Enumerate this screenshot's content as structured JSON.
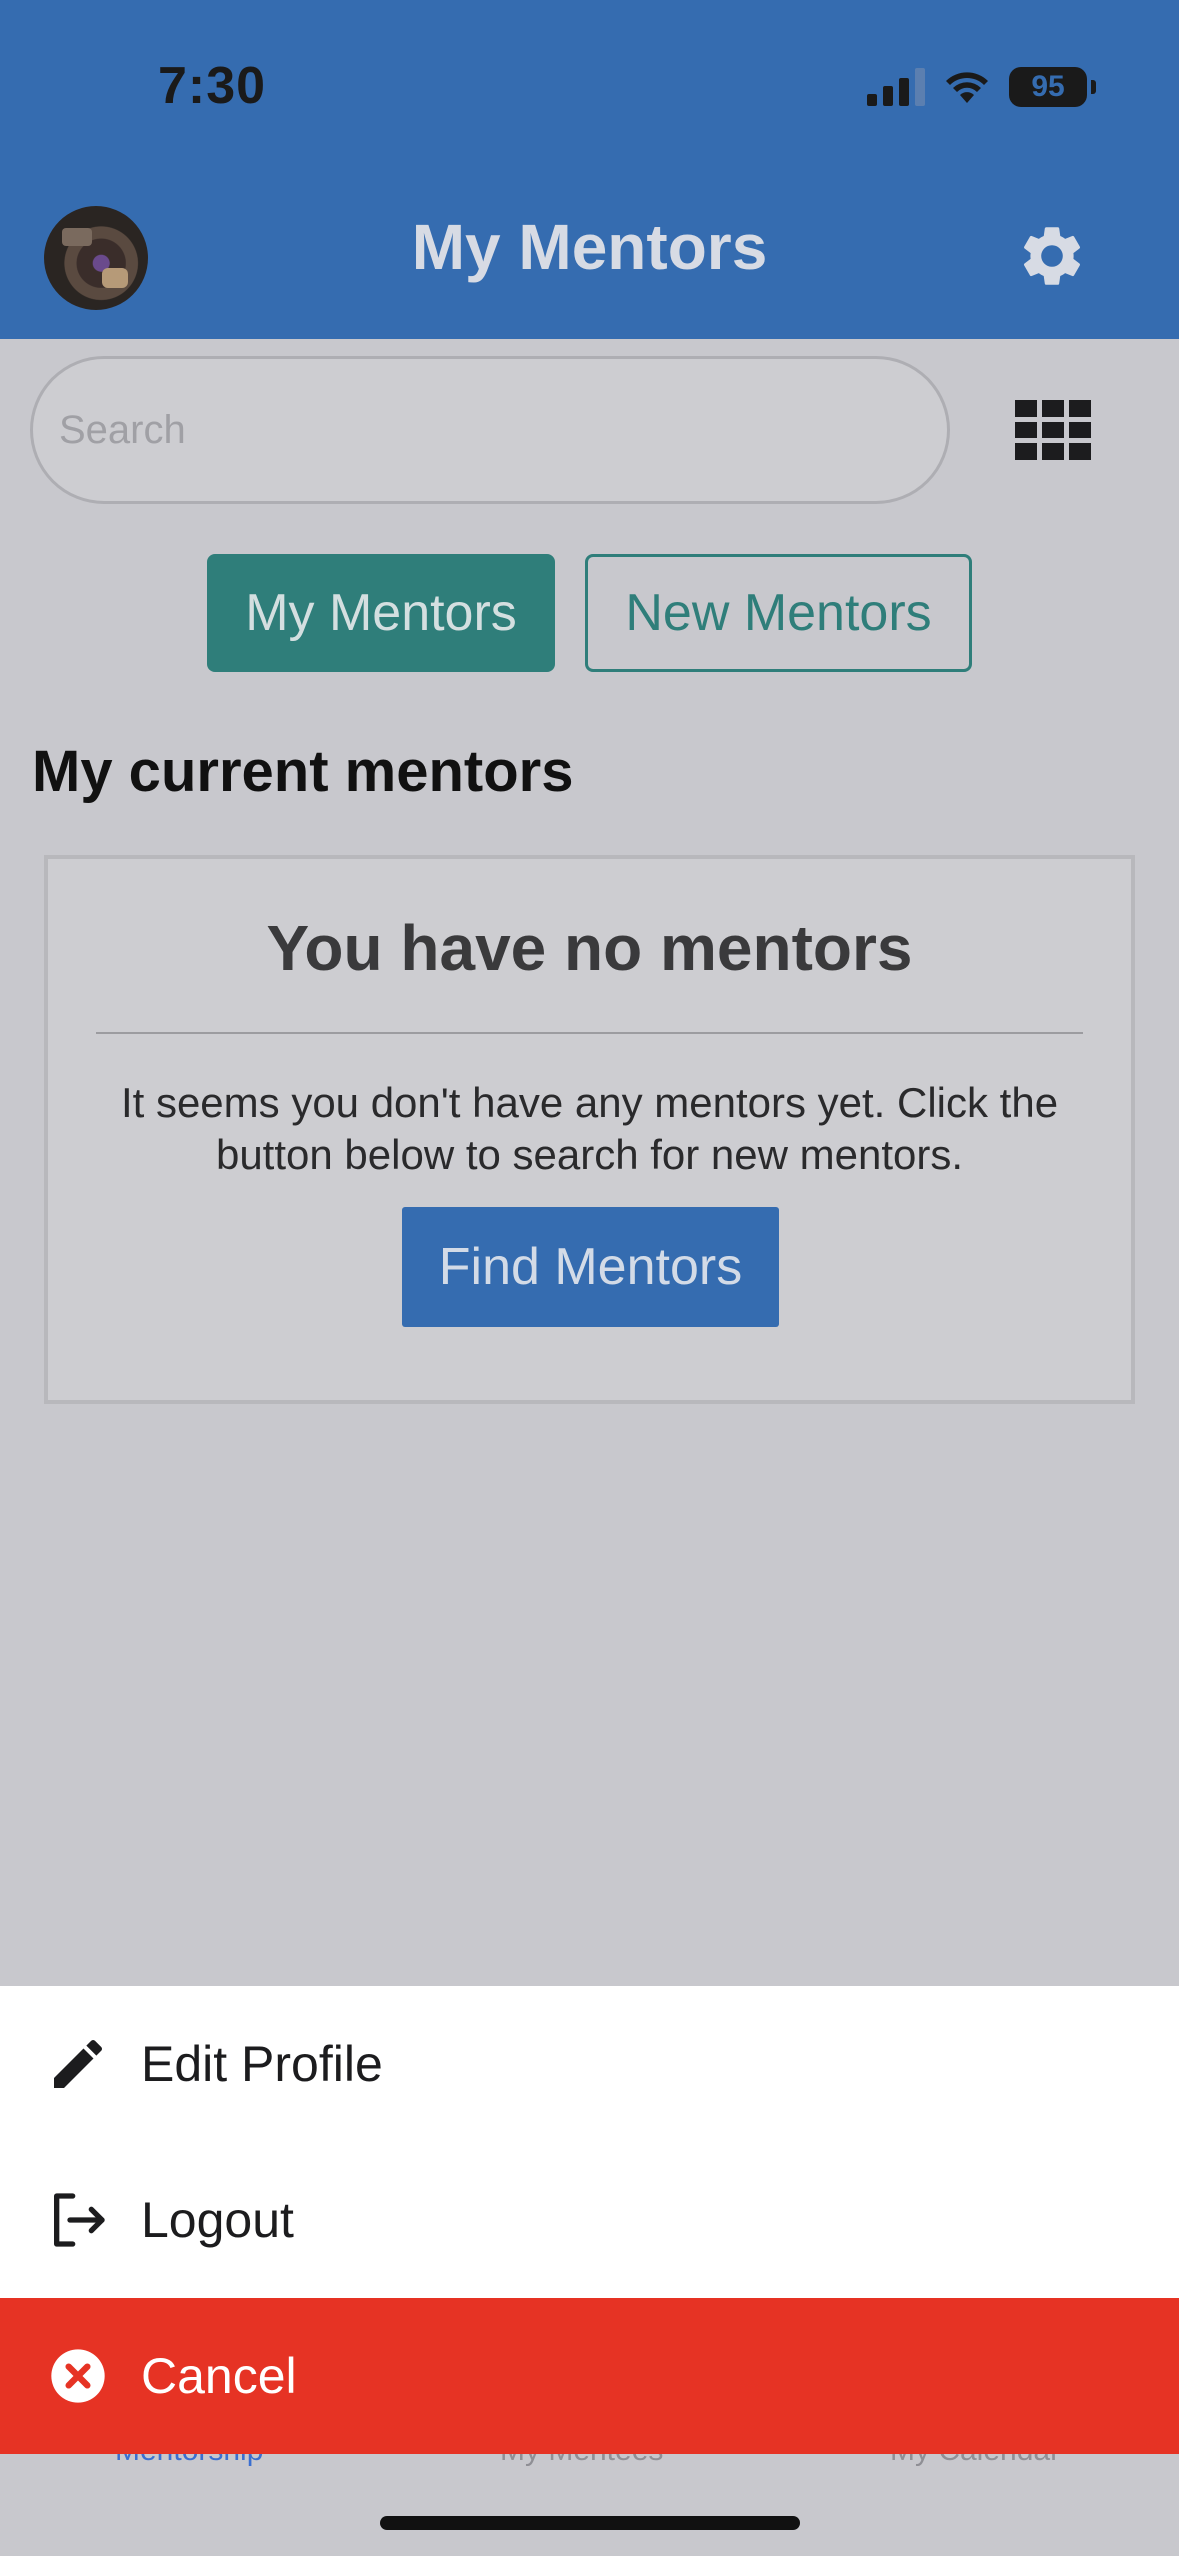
{
  "status_bar": {
    "time": "7:30",
    "battery": "95"
  },
  "header": {
    "title": "My Mentors"
  },
  "search": {
    "placeholder": "Search"
  },
  "tabs": [
    {
      "label": "My Mentors",
      "active": true
    },
    {
      "label": "New Mentors",
      "active": false
    }
  ],
  "section": {
    "title": "My current mentors"
  },
  "empty_card": {
    "title": "You have no mentors",
    "message": "It seems you don't have any mentors yet. Click the button below to search for new mentors.",
    "button": "Find Mentors"
  },
  "bottom_nav": [
    {
      "label": "Mentorship",
      "active": true
    },
    {
      "label": "My Mentees",
      "active": false
    },
    {
      "label": "My Calendar",
      "active": false
    }
  ],
  "action_sheet": {
    "items": [
      {
        "label": "Edit Profile",
        "icon": "pencil-icon"
      },
      {
        "label": "Logout",
        "icon": "logout-icon"
      },
      {
        "label": "Cancel",
        "icon": "close-circle-icon"
      }
    ]
  },
  "colors": {
    "header": "#356cb0",
    "tab_active": "#2f7e7a",
    "primary_button": "#356cb0",
    "cancel": "#e63324"
  }
}
